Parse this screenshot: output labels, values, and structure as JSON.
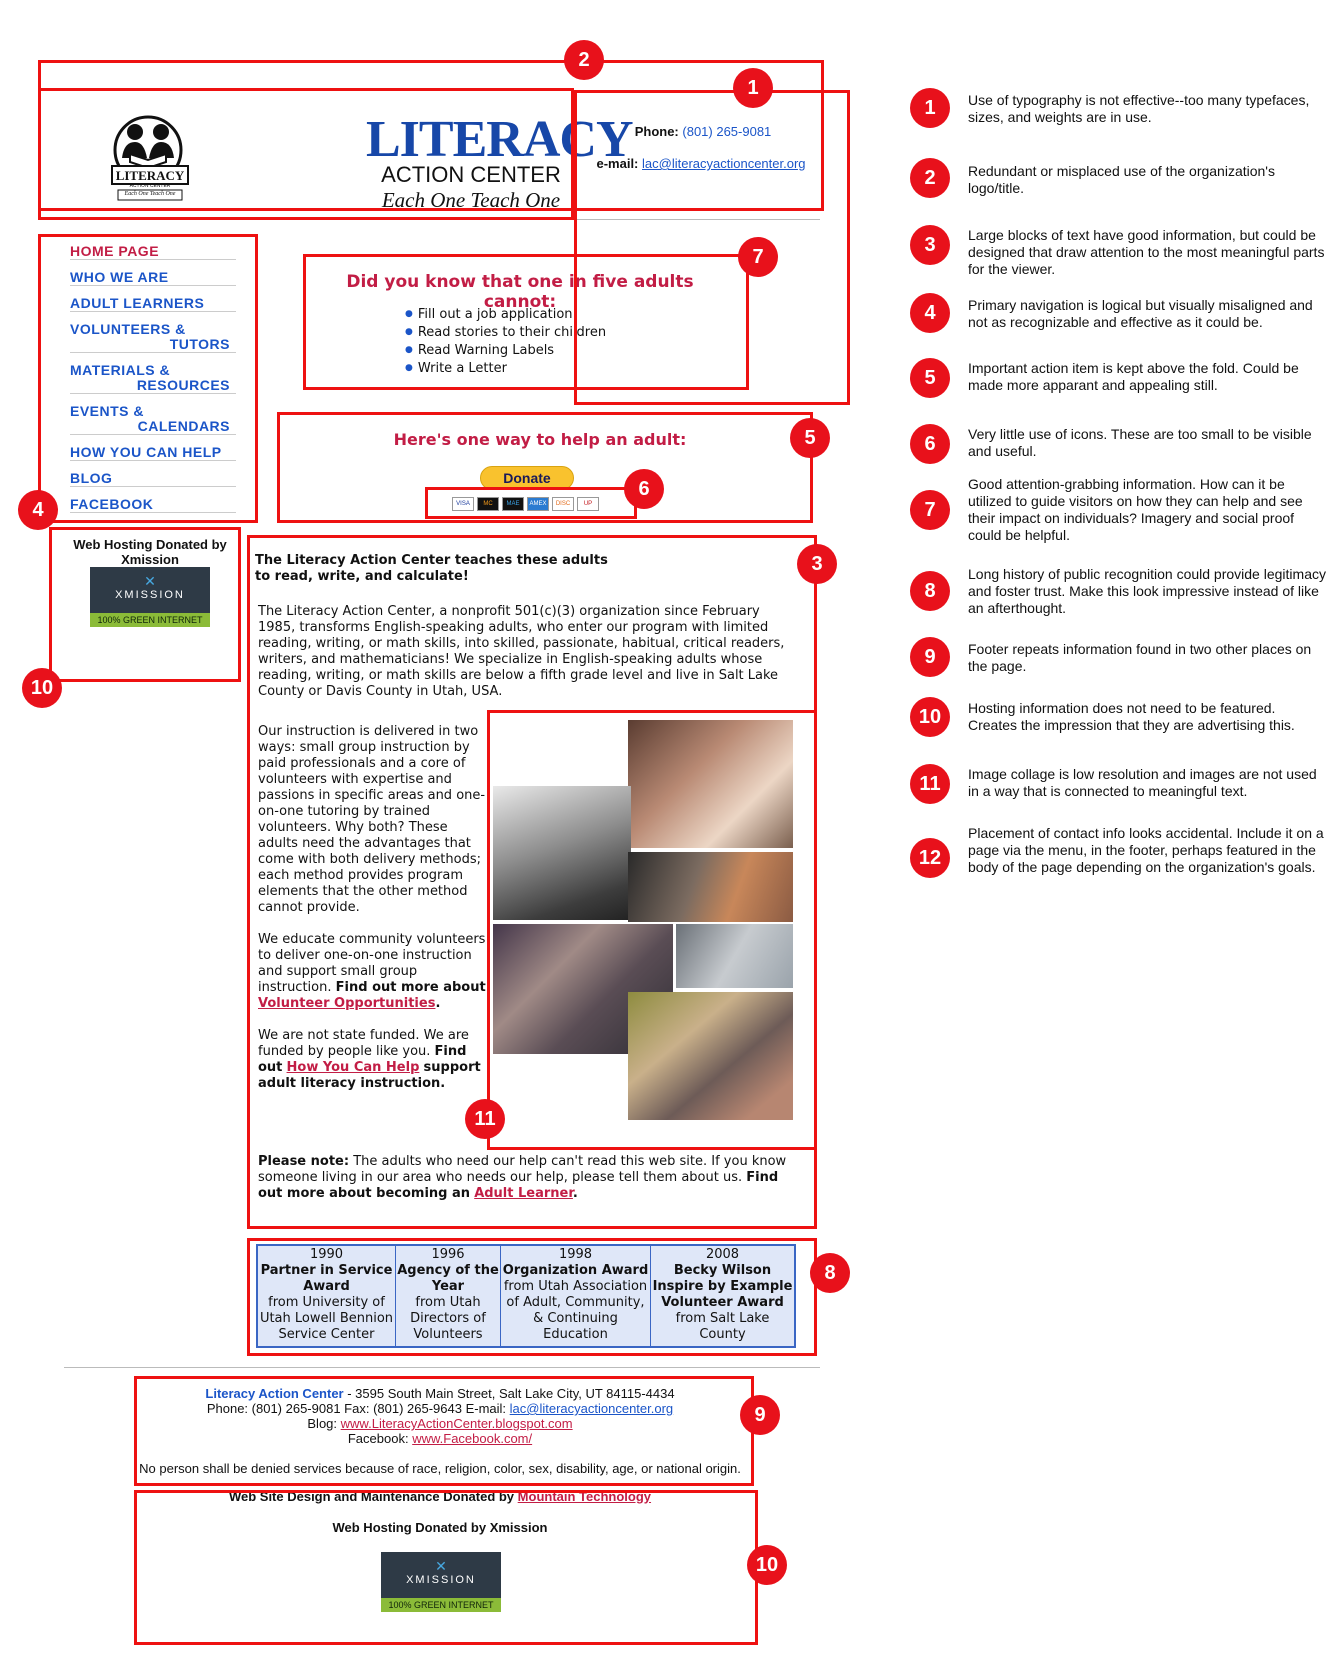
{
  "header": {
    "logo_text": "LITERACY",
    "logo_sub": "ACTION CENTER",
    "logo_tag": "Each One Teach One",
    "title": "LITERACY",
    "subtitle": "ACTION CENTER",
    "tagline": "Each One Teach One",
    "phone_label": "Phone:",
    "phone": "(801) 265-9081",
    "email_label": "e-mail:",
    "email": "lac@literacyactioncenter.org"
  },
  "nav": {
    "items": [
      {
        "l1": "HOME PAGE",
        "l2": ""
      },
      {
        "l1": "WHO WE ARE",
        "l2": ""
      },
      {
        "l1": "ADULT LEARNERS",
        "l2": ""
      },
      {
        "l1": "VOLUNTEERS &",
        "l2": "TUTORS"
      },
      {
        "l1": "MATERIALS &",
        "l2": "RESOURCES"
      },
      {
        "l1": "EVENTS &",
        "l2": "CALENDARS"
      },
      {
        "l1": "HOW YOU CAN HELP",
        "l2": ""
      },
      {
        "l1": "BLOG",
        "l2": ""
      },
      {
        "l1": "FACEBOOK",
        "l2": ""
      }
    ]
  },
  "sidebar": {
    "hosting": "Web Hosting Donated by Xmission"
  },
  "xmission": {
    "name": "XMISSION",
    "green": "100% GREEN INTERNET"
  },
  "did_you_know": {
    "title": "Did you know that one in five adults cannot:",
    "items": [
      "Fill out a job application",
      "Read stories to their children",
      "Read Warning Labels",
      "Write a Letter"
    ]
  },
  "donate": {
    "title": "Here's one way to help an adult:",
    "button": "Donate",
    "cards": [
      "VISA",
      "MC",
      "MAE",
      "AMEX",
      "DISC",
      "UP"
    ]
  },
  "main": {
    "heading_1": "The Literacy Action Center teaches these adults",
    "heading_2": "to read, write, and calculate!",
    "intro": "The Literacy Action Center, a nonprofit 501(c)(3) organization since February 1985, transforms English-speaking adults, who enter our program with limited reading, writing, or math skills, into skilled, passionate, habitual, critical readers, writers, and mathematicians! We specialize in English-speaking adults whose reading, writing, or math skills are below a fifth grade level and live in Salt Lake County or Davis County in Utah, USA.",
    "instruction": "Our instruction is delivered in two ways: small group instruction by paid professionals and a core of volunteers with expertise and passions in specific areas and one-on-one tutoring by trained volunteers. Why both? These adults need the advantages that come with both delivery methods; each method provides program elements that the other method cannot provide.",
    "volunteers": "We educate community volunteers to deliver one-on-one instruction and support small group instruction.",
    "volunteers_bold": "Find out more about",
    "volunteers_link": "Volunteer Opportunities",
    "funding": "We are not state funded. We are funded by people like you.",
    "funding_bold_1": "Find out",
    "funding_link": "How You Can Help",
    "funding_bold_2": "support adult literacy instruction.",
    "note_label": "Please note:",
    "note": "The adults who need our help can't read this web site. If you know someone living in our area who needs our help, please tell them about us.",
    "note_bold": "Find out more about becoming an",
    "note_link": "Adult Learner"
  },
  "awards": [
    {
      "year": "1990",
      "title": "Partner in Service Award",
      "from": "from University of Utah Lowell Bennion Service Center"
    },
    {
      "year": "1996",
      "title": "Agency of the Year",
      "from": "from Utah Directors of Volunteers"
    },
    {
      "year": "1998",
      "title": "Organization Award",
      "from": "from Utah Association of Adult, Community, & Continuing Education"
    },
    {
      "year": "2008",
      "title": "Becky Wilson Inspire by Example Volunteer Award",
      "from": "from Salt Lake County"
    }
  ],
  "footer": {
    "org": "Literacy Action Center",
    "address": " - 3595 South Main Street, Salt Lake City, UT 84115-4434",
    "phone_line": "Phone: (801) 265-9081 Fax: (801) 265-9643  E-mail:",
    "email": "lac@literacyactioncenter.org",
    "blog_label": "Blog:",
    "blog": "www.LiteracyActionCenter.blogspot.com",
    "facebook_label": "Facebook:",
    "facebook": "www.Facebook.com/",
    "nondiscrimination": "No person shall be denied services because of race, religion, color, sex, disability, age, or national origin.",
    "design_credit": "Web Site Design and Maintenance Donated by",
    "design_link": "Mountain Technology",
    "hosting": "Web Hosting Donated by Xmission"
  },
  "badges": [
    "1",
    "2",
    "3",
    "4",
    "5",
    "6",
    "7",
    "8",
    "9",
    "10",
    "11",
    "12"
  ],
  "annotations": [
    {
      "n": "1",
      "text": "Use of typography is not effective--too many typefaces, sizes, and weights are in use."
    },
    {
      "n": "2",
      "text": "Redundant or misplaced use of the organization's logo/title."
    },
    {
      "n": "3",
      "text": "Large blocks of text have good information, but could be designed that draw attention to the most meaningful parts for the viewer."
    },
    {
      "n": "4",
      "text": "Primary navigation is logical but visually misaligned and not as recognizable and effective as it could be."
    },
    {
      "n": "5",
      "text": "Important action item is kept above the fold. Could be made more apparant and appealing still."
    },
    {
      "n": "6",
      "text": "Very little use of icons. These are too small to be visible and useful."
    },
    {
      "n": "7",
      "text": "Good attention-grabbing information. How can it be utilized to guide visitors on how they can help and see their impact on individuals? Imagery and social proof could be helpful."
    },
    {
      "n": "8",
      "text": "Long history of public recognition could provide legitimacy and foster trust. Make this look impressive instead of like an afterthought."
    },
    {
      "n": "9",
      "text": "Footer repeats information found in two other places on the page."
    },
    {
      "n": "10",
      "text": "Hosting information does not need to be featured. Creates the impression that they are advertising this."
    },
    {
      "n": "11",
      "text": "Image collage is low resolution and images are not used in a way that is connected to meaningful text."
    },
    {
      "n": "12",
      "text": "Placement of contact info looks accidental. Include it on a page via the menu, in the footer, perhaps featured in the body of the page depending on the organization's goals."
    }
  ],
  "colors": {
    "annotation_red": "#e8111b",
    "link_blue": "#1b55c8",
    "accent_red": "#c21d45"
  }
}
